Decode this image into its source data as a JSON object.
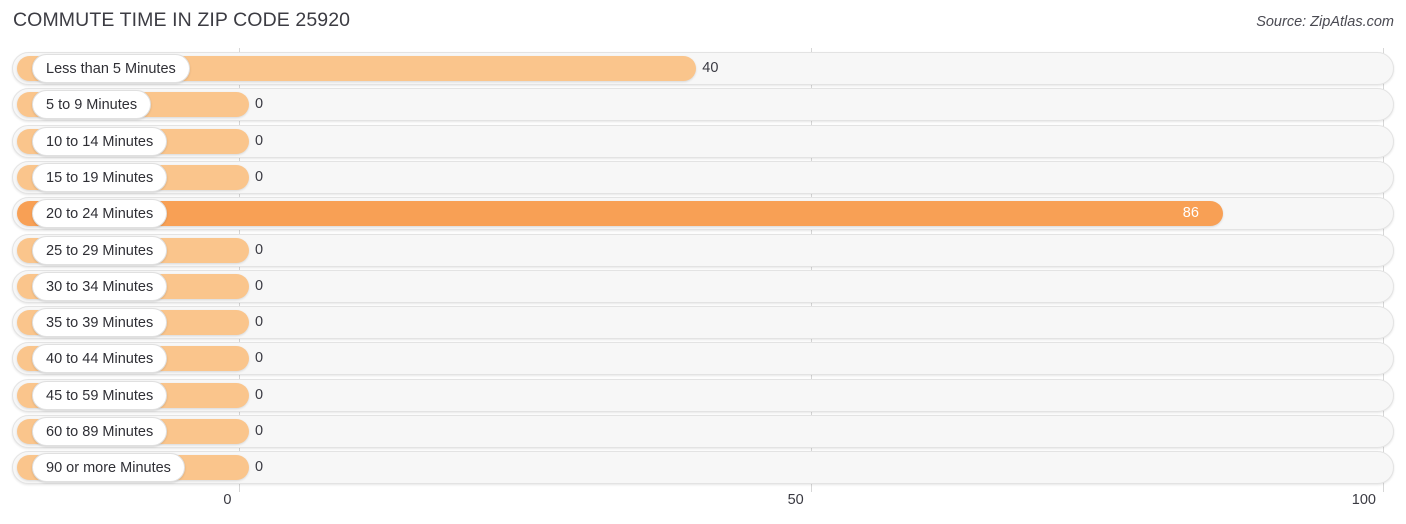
{
  "header": {
    "title": "COMMUTE TIME IN ZIP CODE 25920",
    "source": "Source: ZipAtlas.com"
  },
  "colors": {
    "bar_light": "#fac58c",
    "bar_dark": "#f8a055",
    "track": "#f7f7f7",
    "gridline": "#d7d7d7",
    "text": "#3a3a42"
  },
  "chart_data": {
    "type": "bar",
    "orientation": "horizontal",
    "title": "COMMUTE TIME IN ZIP CODE 25920",
    "xlabel": "",
    "ylabel": "",
    "xlim": [
      0,
      100
    ],
    "grid": true,
    "legend": false,
    "xticks": [
      "0",
      "50",
      "100"
    ],
    "xtick_values": [
      0,
      50,
      100
    ],
    "categories": [
      "Less than 5 Minutes",
      "5 to 9 Minutes",
      "10 to 14 Minutes",
      "15 to 19 Minutes",
      "20 to 24 Minutes",
      "25 to 29 Minutes",
      "30 to 34 Minutes",
      "35 to 39 Minutes",
      "40 to 44 Minutes",
      "45 to 59 Minutes",
      "60 to 89 Minutes",
      "90 or more Minutes"
    ],
    "values": [
      40,
      0,
      0,
      0,
      86,
      0,
      0,
      0,
      0,
      0,
      0,
      0
    ],
    "value_labels": [
      "40",
      "0",
      "0",
      "0",
      "86",
      "0",
      "0",
      "0",
      "0",
      "0",
      "0",
      "0"
    ],
    "highlight_index": 4
  },
  "rows": [
    {
      "label": "Less than 5 Minutes",
      "value": 40,
      "value_label": "40",
      "highlight": false
    },
    {
      "label": "5 to 9 Minutes",
      "value": 0,
      "value_label": "0",
      "highlight": false
    },
    {
      "label": "10 to 14 Minutes",
      "value": 0,
      "value_label": "0",
      "highlight": false
    },
    {
      "label": "15 to 19 Minutes",
      "value": 0,
      "value_label": "0",
      "highlight": false
    },
    {
      "label": "20 to 24 Minutes",
      "value": 86,
      "value_label": "86",
      "highlight": true
    },
    {
      "label": "25 to 29 Minutes",
      "value": 0,
      "value_label": "0",
      "highlight": false
    },
    {
      "label": "30 to 34 Minutes",
      "value": 0,
      "value_label": "0",
      "highlight": false
    },
    {
      "label": "35 to 39 Minutes",
      "value": 0,
      "value_label": "0",
      "highlight": false
    },
    {
      "label": "40 to 44 Minutes",
      "value": 0,
      "value_label": "0",
      "highlight": false
    },
    {
      "label": "45 to 59 Minutes",
      "value": 0,
      "value_label": "0",
      "highlight": false
    },
    {
      "label": "60 to 89 Minutes",
      "value": 0,
      "value_label": "0",
      "highlight": false
    },
    {
      "label": "90 or more Minutes",
      "value": 0,
      "value_label": "0",
      "highlight": false
    }
  ],
  "axis": {
    "ticks": [
      {
        "label": "0",
        "value": 0
      },
      {
        "label": "50",
        "value": 50
      },
      {
        "label": "100",
        "value": 100
      }
    ]
  }
}
